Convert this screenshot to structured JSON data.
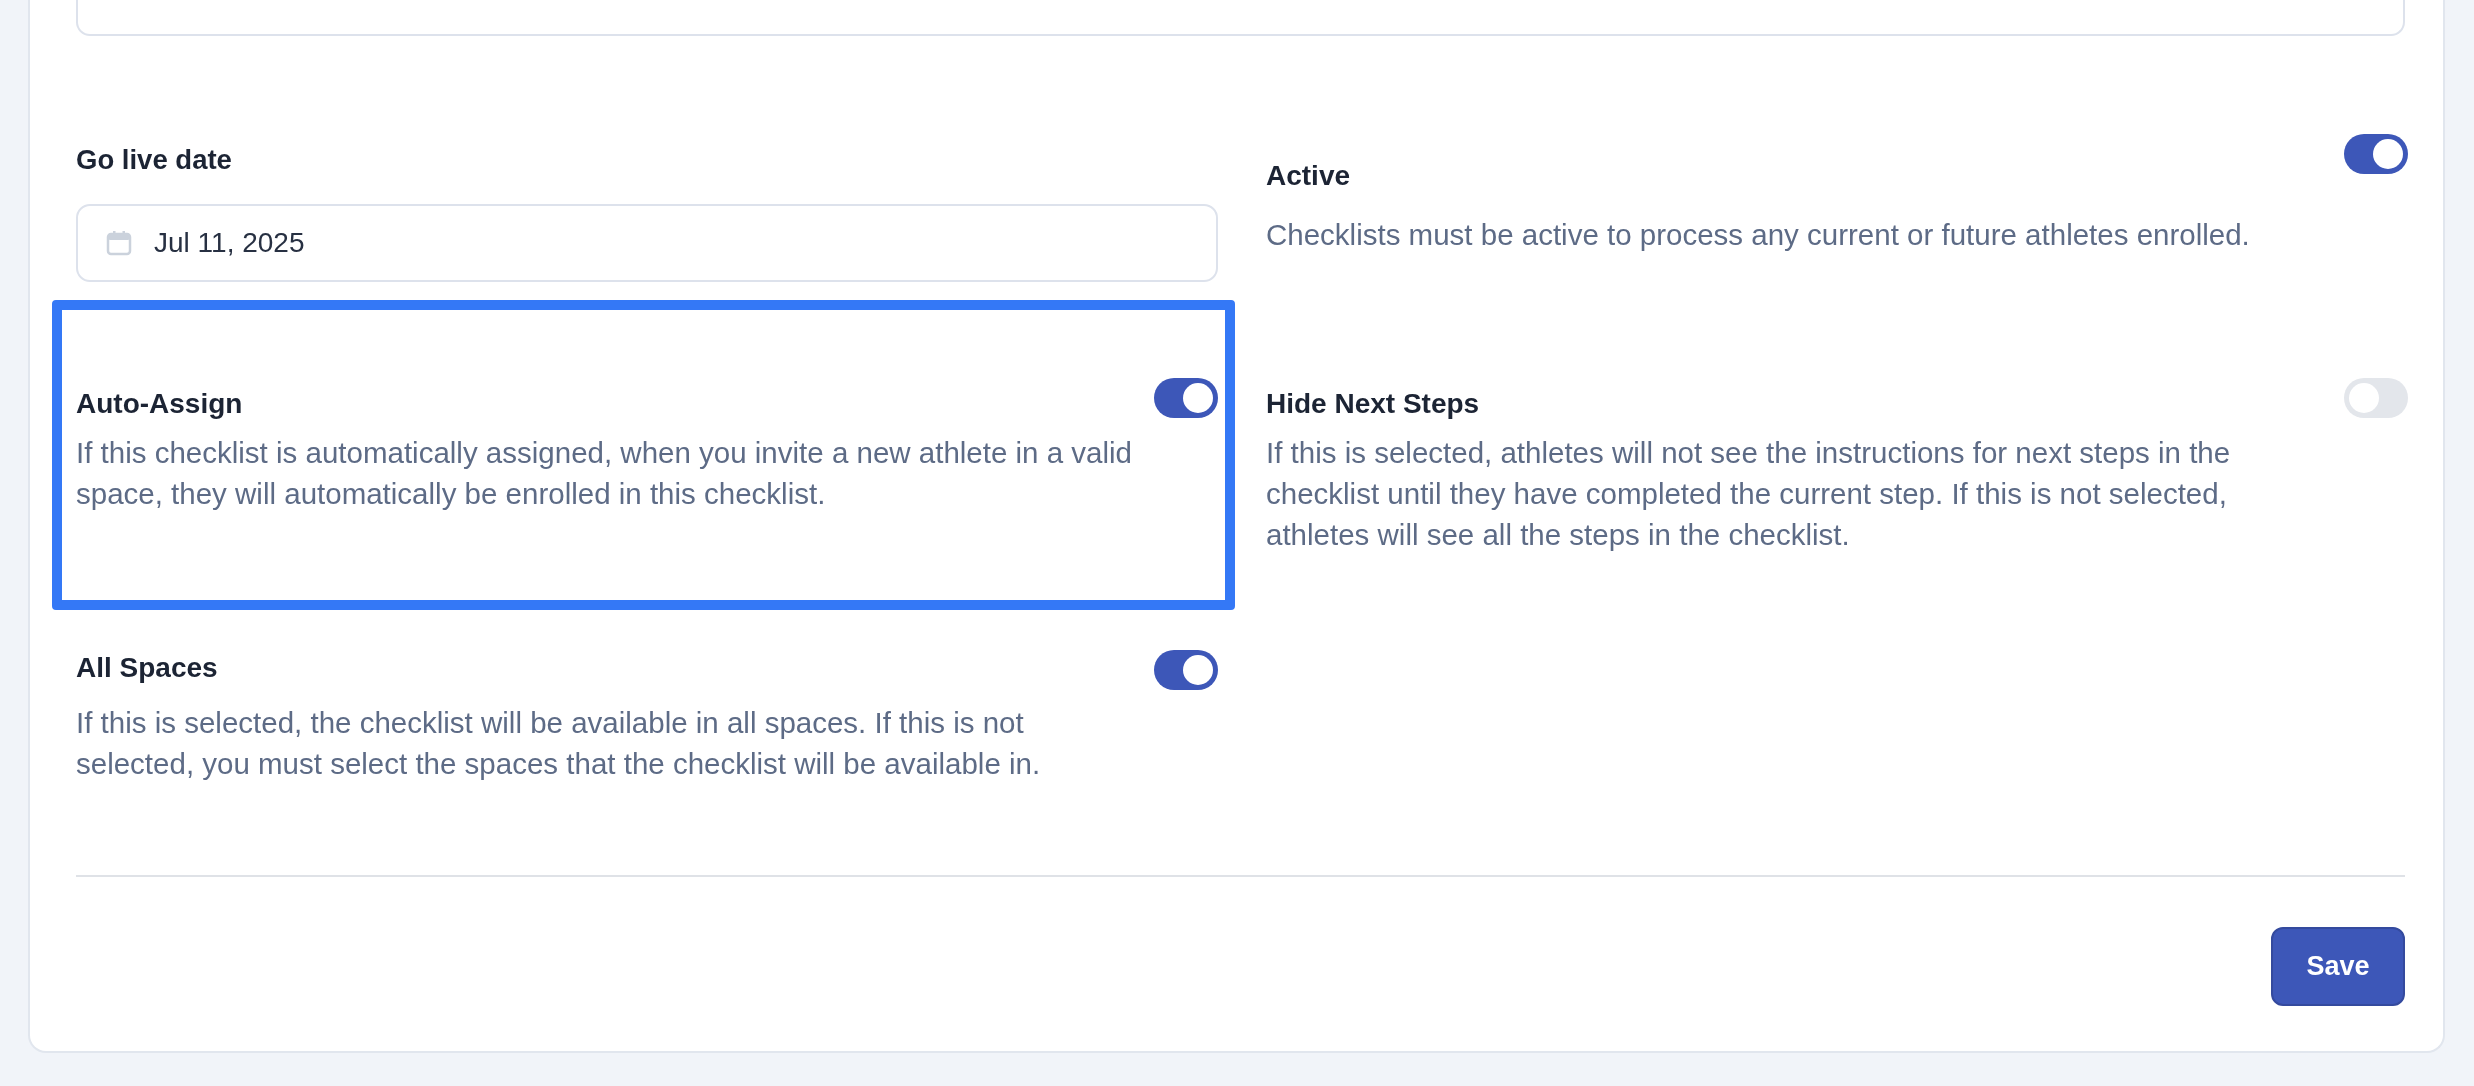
{
  "rows": [
    {
      "cells": [
        {
          "kind": "date",
          "label": "Go live date",
          "value": "Jul 11, 2025"
        },
        {
          "kind": "toggle",
          "title": "Active",
          "description": "Checklists must be active to process any current or future athletes enrolled.",
          "on": true,
          "highlighted": false
        }
      ]
    },
    {
      "cells": [
        {
          "kind": "toggle",
          "title": "Auto-Assign",
          "description": "If this checklist is automatically assigned, when you invite a new athlete in a valid space, they will automatically be enrolled in this checklist.",
          "on": true,
          "highlighted": true
        },
        {
          "kind": "toggle",
          "title": "Hide Next Steps",
          "description": "If this is selected, athletes will not see the instructions for next steps in the checklist until they have completed the current step. If this is not selected, athletes will see all the steps in the checklist.",
          "on": false,
          "highlighted": false
        }
      ]
    },
    {
      "cells": [
        {
          "kind": "toggle",
          "title": "All Spaces",
          "description": "If this is selected, the checklist will be available in all spaces. If this is not selected, you must select the spaces that the checklist will be available in.",
          "on": true,
          "highlighted": false
        }
      ]
    }
  ],
  "save_button": {
    "label": "Save"
  }
}
